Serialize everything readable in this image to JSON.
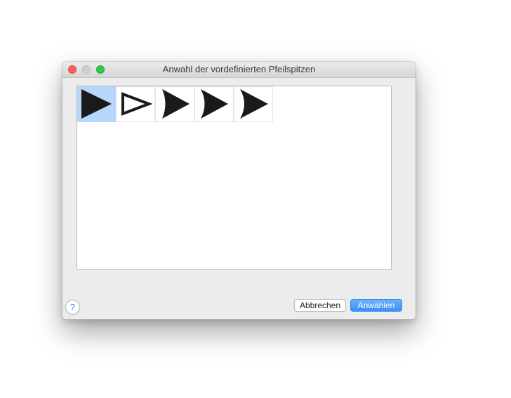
{
  "window": {
    "title": "Anwahl der vordefinierten Pfeilspitzen"
  },
  "arrowheads": [
    {
      "style": "filled-triangle",
      "selected": true
    },
    {
      "style": "outline-triangle",
      "selected": false
    },
    {
      "style": "concave-arrow",
      "selected": false
    },
    {
      "style": "concave-arrow-deep",
      "selected": false
    },
    {
      "style": "concave-arrow-sharp",
      "selected": false
    }
  ],
  "footer": {
    "help_label": "?",
    "cancel_label": "Abbrechen",
    "ok_label": "Anwählen"
  },
  "colors": {
    "selection": "#b7d6fb",
    "accent": "#3a8ef5",
    "arrow": "#1a1a1a"
  }
}
